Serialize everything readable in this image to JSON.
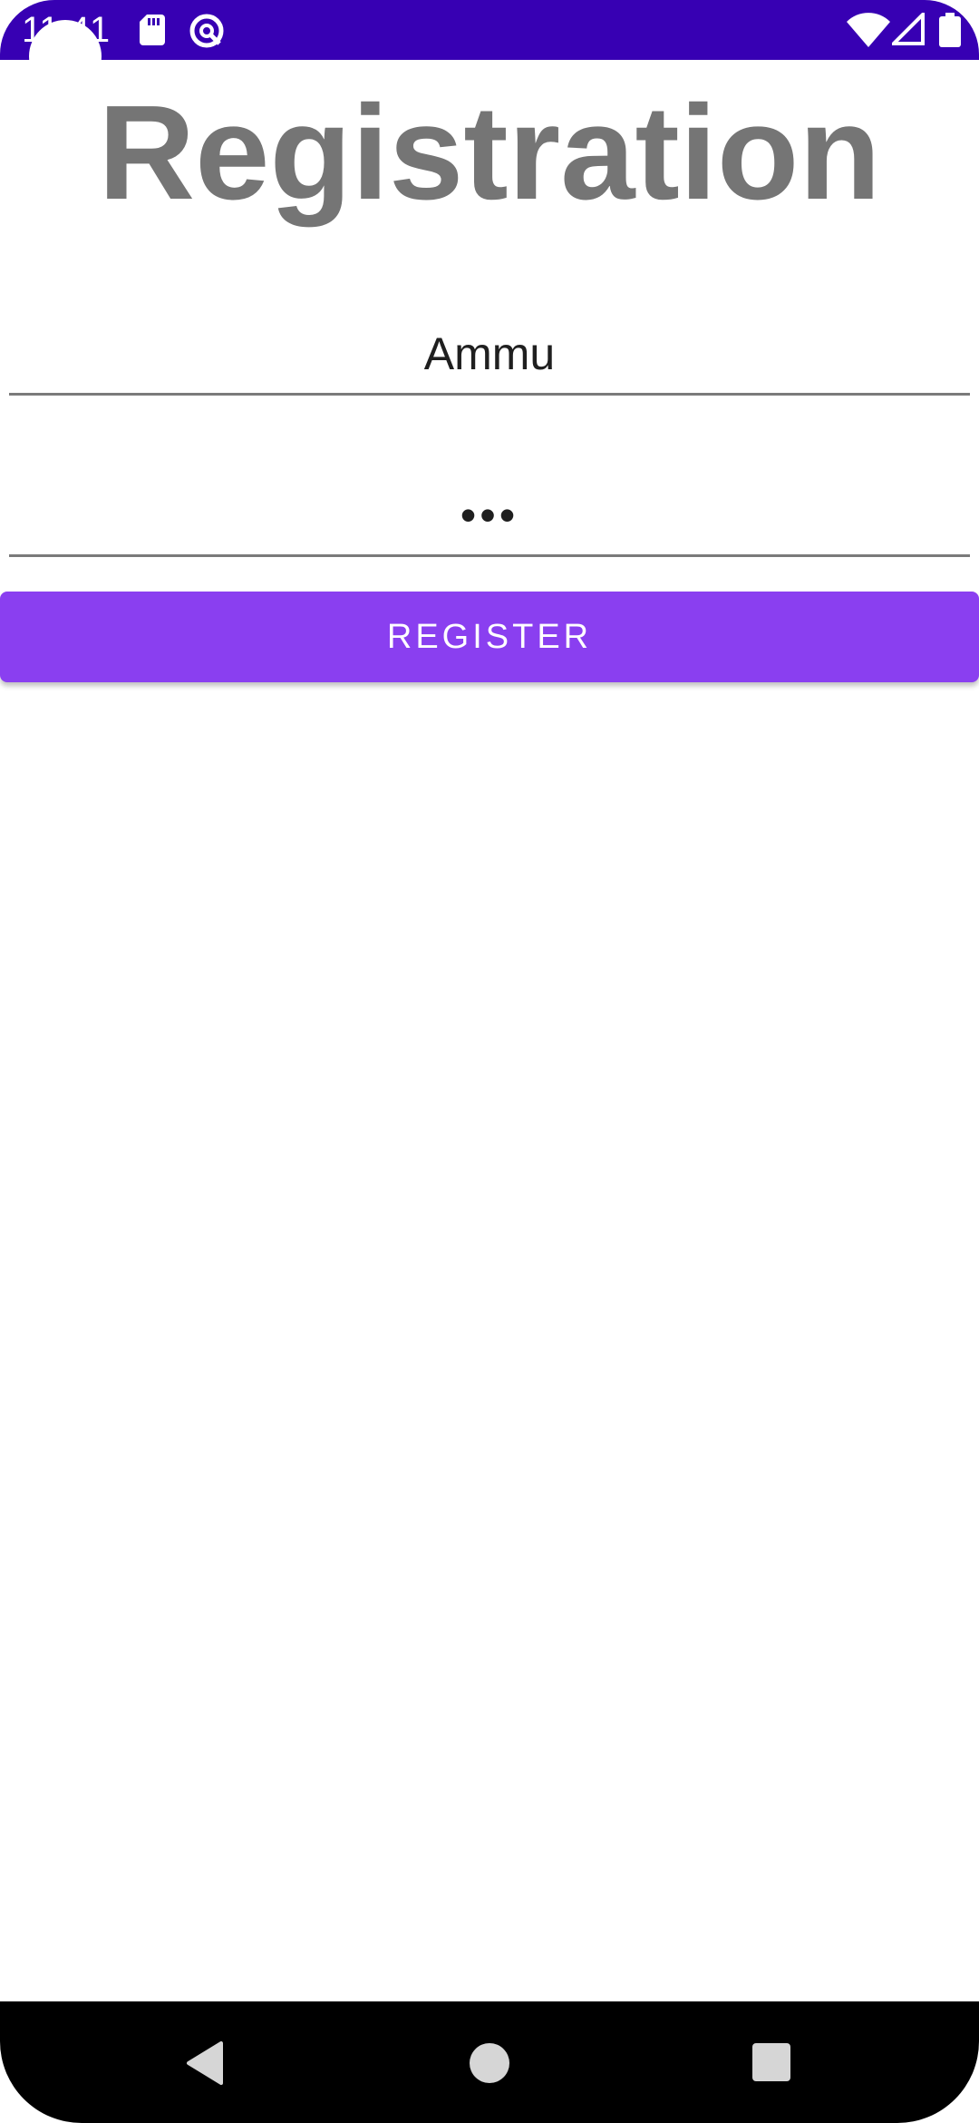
{
  "status_bar": {
    "time": "11:41",
    "icons": [
      "sd-card-icon",
      "vpn-icon",
      "wifi-icon",
      "signal-icon",
      "battery-icon"
    ],
    "background_color": "#3700b3"
  },
  "page": {
    "title": "Registration"
  },
  "form": {
    "name_value": "Ammu",
    "password_value": "•••",
    "register_label": "REGISTER",
    "button_color": "#8a3ff0"
  },
  "nav_bar": {
    "icons": [
      "back-icon",
      "home-icon",
      "recents-icon"
    ]
  }
}
